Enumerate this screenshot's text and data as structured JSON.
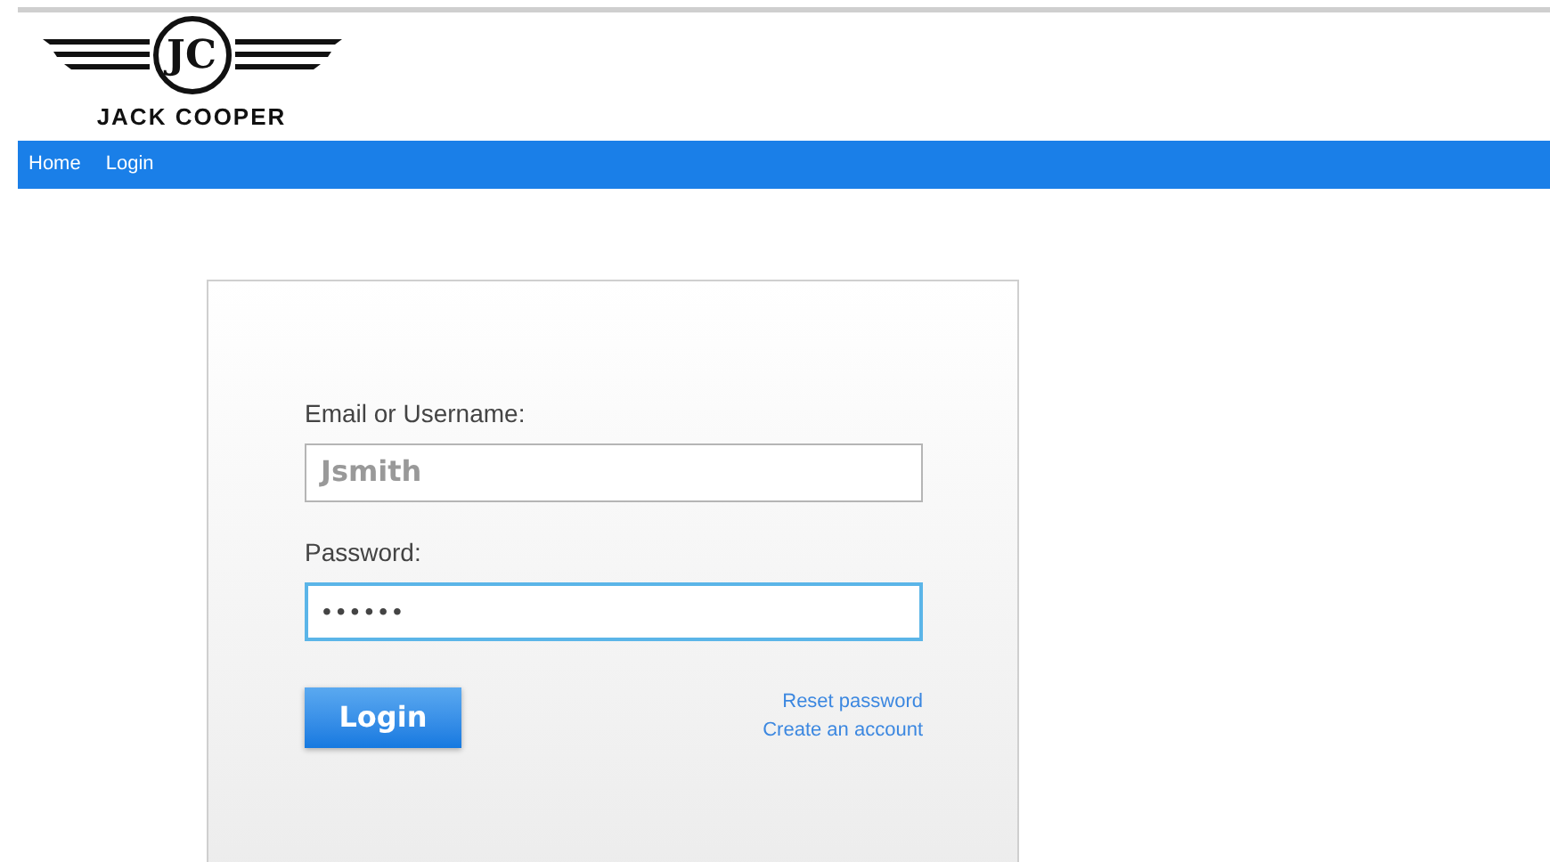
{
  "logo": {
    "monogram": "JC",
    "name": "JACK COOPER"
  },
  "nav": [
    {
      "label": "Home"
    },
    {
      "label": "Login"
    }
  ],
  "form": {
    "username": {
      "label": "Email or Username:",
      "placeholder": "Jsmith",
      "focused": false
    },
    "password": {
      "label": "Password:",
      "value": "••••••",
      "focused": true
    },
    "submit": "Login",
    "links": [
      "Reset password",
      "Create an account"
    ]
  }
}
